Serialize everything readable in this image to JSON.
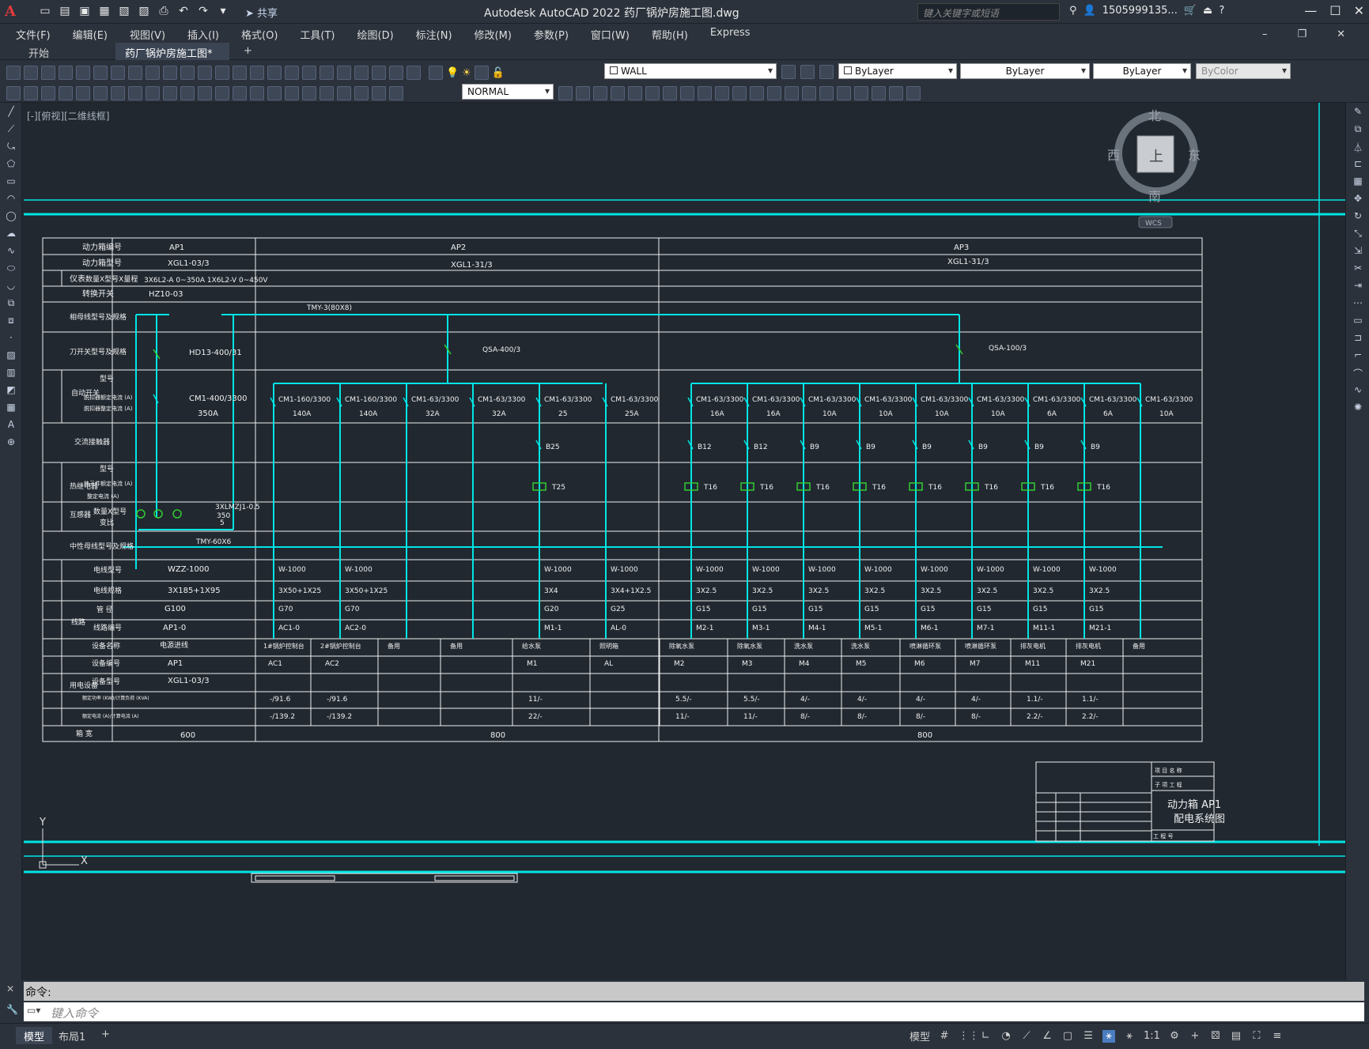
{
  "window": {
    "app_logo": "A",
    "title": "Autodesk AutoCAD 2022    药厂锅炉房施工图.dwg",
    "search_placeholder": "键入关键字或短语",
    "user": "1505999135...",
    "share_label": "共享"
  },
  "menu": [
    "文件(F)",
    "编辑(E)",
    "视图(V)",
    "插入(I)",
    "格式(O)",
    "工具(T)",
    "绘图(D)",
    "标注(N)",
    "修改(M)",
    "参数(P)",
    "窗口(W)",
    "帮助(H)",
    "Express"
  ],
  "tabs": {
    "start": "开始",
    "doc": "药厂锅炉房施工图*",
    "add": "+"
  },
  "toolbar": {
    "layer_value": "WALL",
    "color_value": "ByLayer",
    "linetype_value": "ByLayer",
    "lineweight_value": "ByLayer",
    "plotstyle_value": "ByColor",
    "dimstyle_value": "NORMAL"
  },
  "viewport": {
    "label": "[-][俯视][二维线框]",
    "viewcube": {
      "north": "北",
      "south": "南",
      "east": "东",
      "west": "西",
      "face": "上",
      "wcs": "WCS"
    },
    "ucs": {
      "x": "X",
      "y": "Y"
    }
  },
  "drawing": {
    "row_headers": [
      "动力箱编号",
      "动力箱型号",
      "仪表",
      "数量X型号X量程",
      "转换开关",
      "相母线型号及规格",
      "刀开关型号及规格",
      "自动开关",
      "型号",
      "脱扣器额定电流 (A)",
      "脱扣器整定电流 (A)",
      "交流接触器",
      "热继电器",
      "型号",
      "热元件额定电流 (A)",
      "整定电流 (A)",
      "互感器",
      "数量X型号",
      "变比",
      "中性母线型号及规格",
      "线路",
      "电线型号",
      "电线规格",
      "管 径",
      "线路编号",
      "用电设备",
      "设备名称",
      "设备编号",
      "设备型号",
      "额定功率 (KW)/计算负荷 (KVA)",
      "额定电流 (A)/计算电流 (A)",
      "箱 宽"
    ],
    "panels": {
      "ap1": {
        "code": "AP1",
        "model": "XGL1-03/3",
        "meters": "3X6L2-A  0~350A   1X6L2-V  0~450V",
        "switch": "HZ10-03",
        "knife": "HD13-400/31",
        "breaker": "CM1-400/3300",
        "breaker_rating": "350A",
        "ct": "3XLMZJ1-0.5",
        "ct_ratio_a": "350",
        "ct_ratio_b": "5",
        "busbar": "TMY-60X6",
        "wire": "WZZ-1000",
        "cable": "3X185+1X95",
        "conduit": "G100",
        "circuit": "AP1-0",
        "dev_name": "电源进线",
        "dev_code": "AP1",
        "dev_model": "XGL1-03/3",
        "width": "600"
      },
      "ap2": {
        "code": "AP2",
        "model": "XGL1-31/3",
        "busbar": "TMY-3(80X8)",
        "knife": "QSA-400/3",
        "width": "800"
      },
      "ap3": {
        "code": "AP3",
        "model": "XGL1-31/3",
        "knife": "QSA-100/3",
        "width": "800"
      }
    },
    "ap2_circuits": [
      {
        "breaker": "CM1-160/3300",
        "rating": "140A",
        "contactor": "",
        "thermal": "",
        "wire": "W-1000",
        "cable": "3X50+1X25",
        "conduit": "G70",
        "circuit": "AC1-0",
        "dev_name": "1#锅炉控制台",
        "dev_code": "AC1",
        "power": "-/91.6",
        "current": "-/139.2"
      },
      {
        "breaker": "CM1-160/3300",
        "rating": "140A",
        "contactor": "",
        "thermal": "",
        "wire": "W-1000",
        "cable": "3X50+1X25",
        "conduit": "G70",
        "circuit": "AC2-0",
        "dev_name": "2#锅炉控制台",
        "dev_code": "AC2",
        "power": "-/91.6",
        "current": "-/139.2"
      },
      {
        "breaker": "CM1-63/3300",
        "rating": "32A",
        "contactor": "",
        "thermal": "",
        "wire": "",
        "cable": "",
        "conduit": "",
        "circuit": "",
        "dev_name": "备用",
        "dev_code": "",
        "power": "",
        "current": ""
      },
      {
        "breaker": "CM1-63/3300",
        "rating": "32A",
        "contactor": "",
        "thermal": "",
        "wire": "",
        "cable": "",
        "conduit": "",
        "circuit": "",
        "dev_name": "备用",
        "dev_code": "",
        "power": "",
        "current": ""
      },
      {
        "breaker": "CM1-63/3300",
        "rating": "25",
        "contactor": "B25",
        "thermal": "T25",
        "wire": "W-1000",
        "cable": "3X4",
        "conduit": "G20",
        "circuit": "M1-1",
        "dev_name": "给水泵",
        "dev_code": "M1",
        "power": "11/-",
        "current": "22/-"
      },
      {
        "breaker": "CM1-63/3300",
        "rating": "25A",
        "contactor": "",
        "thermal": "",
        "wire": "W-1000",
        "cable": "3X4+1X2.5",
        "conduit": "G25",
        "circuit": "AL-0",
        "dev_name": "照明箱",
        "dev_code": "AL",
        "power": "",
        "current": ""
      }
    ],
    "ap3_circuits": [
      {
        "breaker": "CM1-63/3300",
        "rating": "16A",
        "contactor": "B12",
        "thermal": "T16",
        "wire": "W-1000",
        "cable": "3X2.5",
        "conduit": "G15",
        "circuit": "M2-1",
        "dev_name": "除氧水泵",
        "dev_code": "M2",
        "power": "5.5/-",
        "current": "11/-"
      },
      {
        "breaker": "CM1-63/3300",
        "rating": "16A",
        "contactor": "B12",
        "thermal": "T16",
        "wire": "W-1000",
        "cable": "3X2.5",
        "conduit": "G15",
        "circuit": "M3-1",
        "dev_name": "除氧水泵",
        "dev_code": "M3",
        "power": "5.5/-",
        "current": "11/-"
      },
      {
        "breaker": "CM1-63/3300",
        "rating": "10A",
        "contactor": "B9",
        "thermal": "T16",
        "wire": "W-1000",
        "cable": "3X2.5",
        "conduit": "G15",
        "circuit": "M4-1",
        "dev_name": "洗水泵",
        "dev_code": "M4",
        "power": "4/-",
        "current": "8/-"
      },
      {
        "breaker": "CM1-63/3300",
        "rating": "10A",
        "contactor": "B9",
        "thermal": "T16",
        "wire": "W-1000",
        "cable": "3X2.5",
        "conduit": "G15",
        "circuit": "M5-1",
        "dev_name": "洗水泵",
        "dev_code": "M5",
        "power": "4/-",
        "current": "8/-"
      },
      {
        "breaker": "CM1-63/3300",
        "rating": "10A",
        "contactor": "B9",
        "thermal": "T16",
        "wire": "W-1000",
        "cable": "3X2.5",
        "conduit": "G15",
        "circuit": "M6-1",
        "dev_name": "喷淋循环泵",
        "dev_code": "M6",
        "power": "4/-",
        "current": "8/-"
      },
      {
        "breaker": "CM1-63/3300",
        "rating": "10A",
        "contactor": "B9",
        "thermal": "T16",
        "wire": "W-1000",
        "cable": "3X2.5",
        "conduit": "G15",
        "circuit": "M7-1",
        "dev_name": "喷淋循环泵",
        "dev_code": "M7",
        "power": "4/-",
        "current": "8/-"
      },
      {
        "breaker": "CM1-63/3300",
        "rating": "6A",
        "contactor": "B9",
        "thermal": "T16",
        "wire": "W-1000",
        "cable": "3X2.5",
        "conduit": "G15",
        "circuit": "M11-1",
        "dev_name": "排灰电机",
        "dev_code": "M11",
        "power": "1.1/-",
        "current": "2.2/-"
      },
      {
        "breaker": "CM1-63/3300",
        "rating": "6A",
        "contactor": "B9",
        "thermal": "T16",
        "wire": "W-1000",
        "cable": "3X2.5",
        "conduit": "G15",
        "circuit": "M21-1",
        "dev_name": "排灰电机",
        "dev_code": "M21",
        "power": "1.1/-",
        "current": "2.2/-"
      },
      {
        "breaker": "CM1-63/3300",
        "rating": "10A",
        "contactor": "",
        "thermal": "",
        "wire": "",
        "cable": "",
        "conduit": "",
        "circuit": "",
        "dev_name": "备用",
        "dev_code": "",
        "power": "",
        "current": ""
      }
    ],
    "titleblock": {
      "line1": "动力箱  AP1",
      "line2": "配电系统图",
      "top1": "项 目 名 称",
      "top2": "子 项 工 程",
      "bottom": "工 程 号"
    }
  },
  "command": {
    "history": "命令:",
    "placeholder": "键入命令"
  },
  "status": {
    "model_tab": "模型",
    "layout1": "布局1",
    "add": "+",
    "model_btn": "模型",
    "scale": "1:1"
  },
  "colors": {
    "cyan": "#00e5e5",
    "green": "#33cc33",
    "white": "#f0f0f0",
    "bg": "#212830",
    "chrome": "#2b323c"
  }
}
